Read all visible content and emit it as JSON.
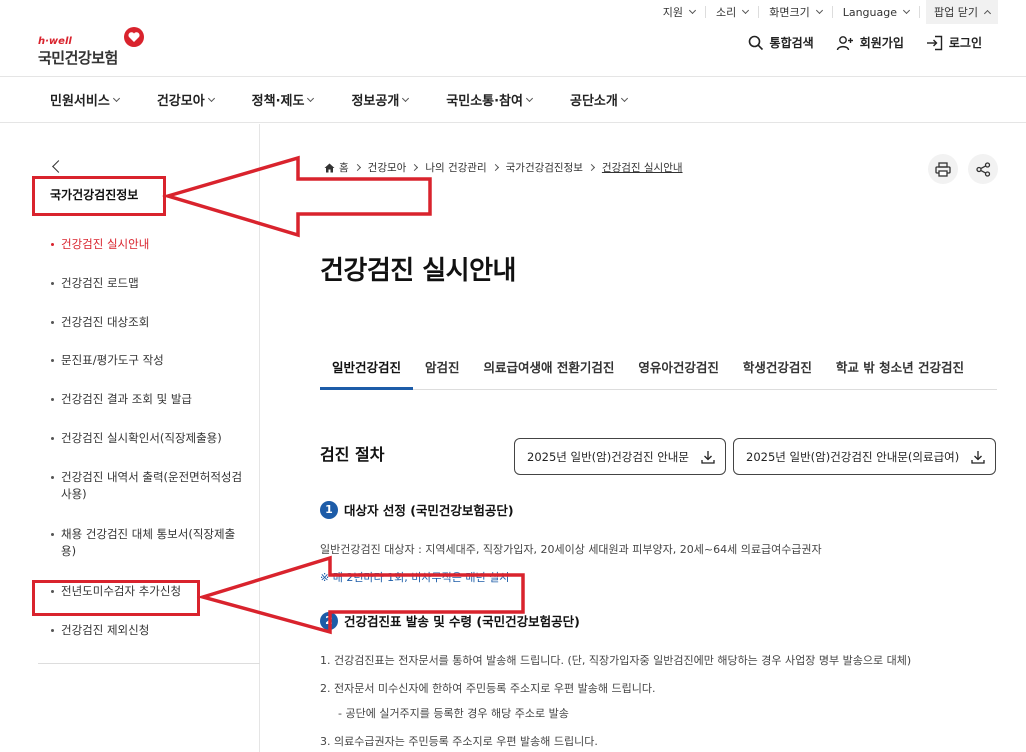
{
  "util": {
    "support": "지원",
    "sound": "소리",
    "screen": "화면크기",
    "language": "Language",
    "popup": "팝업 닫기"
  },
  "logo": {
    "tagline": "h·well",
    "name": "국민건강보험"
  },
  "actions": {
    "search": "통합검색",
    "join": "회원가입",
    "login": "로그인"
  },
  "gnb": [
    "민원서비스",
    "건강모아",
    "정책·제도",
    "정보공개",
    "국민소통·참여",
    "공단소개"
  ],
  "sidebar": {
    "title": "국가건강검진정보",
    "items": [
      "건강검진 실시안내",
      "건강검진 로드맵",
      "건강검진 대상조회",
      "문진표/평가도구 작성",
      "건강검진 결과 조회 및 발급",
      "건강검진 실시확인서(직장제출용)",
      "건강검진 내역서 출력(운전면허적성검사용)",
      "채용 건강검진 대체 통보서(직장제출용)",
      "전년도미수검자 추가신청",
      "건강검진 제외신청"
    ]
  },
  "breadcrumb": [
    "홈",
    "건강모아",
    "나의 건강관리",
    "국가건강검진정보",
    "건강검진 실시안내"
  ],
  "page_title": "건강검진 실시안내",
  "tabs": [
    "일반건강검진",
    "암검진",
    "의료급여생애 전환기검진",
    "영유아건강검진",
    "학생건강검진",
    "학교 밖 청소년 건강검진"
  ],
  "section_title": "검진 절차",
  "downloads": [
    "2025년 일반(암)건강검진 안내문",
    "2025년 일반(암)건강검진 안내문(의료급여)"
  ],
  "steps": [
    {
      "num": "1",
      "title": "대상자 선정 (국민건강보험공단)"
    },
    {
      "num": "2",
      "title": "건강검진표 발송 및 수령 (국민건강보험공단)"
    }
  ],
  "step1_text": "일반건강검진 대상자 : 지역세대주, 직장가입자, 20세이상 세대원과 피부양자, 20세~64세 의료급여수급권자",
  "step1_note": "※ 매 2년마다 1회, 비사무직은 매년 실시",
  "step2_lines": [
    "1.  건강검진표는 전자문서를 통하여 발송해 드립니다. (단, 직장가입자중 일반검진에만 해당하는 경우 사업장 명부 발송으로 대체)",
    "2.  전자문서 미수신자에 한하여 주민등록 주소지로 우편 발송해 드립니다.",
    "- 공단에 실거주지를 등록한 경우 해당 주소로 발송",
    "3.  의료수급권자는 주민등록 주소지로 우편 발송해 드립니다."
  ],
  "colors": {
    "accent": "#d9232d",
    "tab_underline": "#1d5ca8"
  }
}
